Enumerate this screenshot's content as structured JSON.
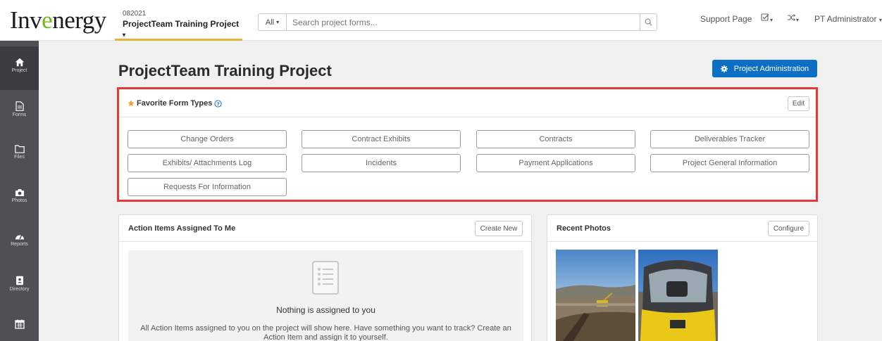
{
  "header": {
    "logo_prefix": "Inv",
    "logo_accent": "e",
    "logo_suffix": "nergy",
    "project_code": "082021",
    "project_name": "ProjectTeam Training Project",
    "search_scope": "All",
    "search_placeholder": "Search project forms...",
    "support_label": "Support Page",
    "user_name": "PT Administrator"
  },
  "sidebar": {
    "items": [
      {
        "label": "Project",
        "icon": "home-icon"
      },
      {
        "label": "Forms",
        "icon": "document-icon"
      },
      {
        "label": "Files",
        "icon": "folder-icon"
      },
      {
        "label": "Photos",
        "icon": "camera-icon"
      },
      {
        "label": "Reports",
        "icon": "dashboard-icon"
      },
      {
        "label": "Directory",
        "icon": "address-book-icon"
      },
      {
        "label": "",
        "icon": "calendar-icon"
      }
    ]
  },
  "main": {
    "title": "ProjectTeam Training Project",
    "admin_button": "Project Administration"
  },
  "favorites": {
    "title": "Favorite Form Types",
    "edit_label": "Edit",
    "items": [
      "Change Orders",
      "Contract Exhibits",
      "Contracts",
      "Deliverables Tracker",
      "Exhibits/ Attachments Log",
      "Incidents",
      "Payment Applications",
      "Project General Information",
      "Requests For Information"
    ]
  },
  "action_items": {
    "title": "Action Items Assigned To Me",
    "button": "Create New",
    "empty_title": "Nothing is assigned to you",
    "empty_desc": "All Action Items assigned to you on the project will show here. Have something you want to track? Create an Action Item and assign it to yourself."
  },
  "recent_photos": {
    "title": "Recent Photos",
    "button": "Configure"
  },
  "colors": {
    "accent_blue": "#0d6ec5",
    "highlight_red": "#e53935",
    "sidebar_bg": "#4e5055",
    "brand_green": "#7ab51d",
    "tab_underline": "#e8b53a"
  }
}
